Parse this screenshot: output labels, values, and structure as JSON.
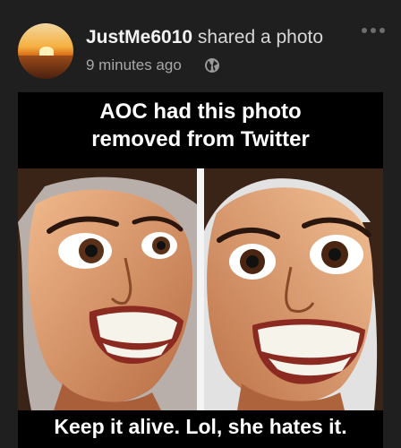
{
  "post": {
    "author_name": "JustMe6010",
    "action_text": "shared a photo",
    "time_ago": "9 minutes ago",
    "privacy_icon": "globe-icon",
    "more_icon": "more-options-icon"
  },
  "image": {
    "caption_line_1": "AOC had this photo",
    "caption_line_2": "removed from Twitter",
    "caption_bottom": "Keep it alive. Lol, she hates it."
  },
  "colors": {
    "background": "#1f1f1f",
    "name_text": "#f2f2f2",
    "meta_text": "#a8a8a8"
  }
}
